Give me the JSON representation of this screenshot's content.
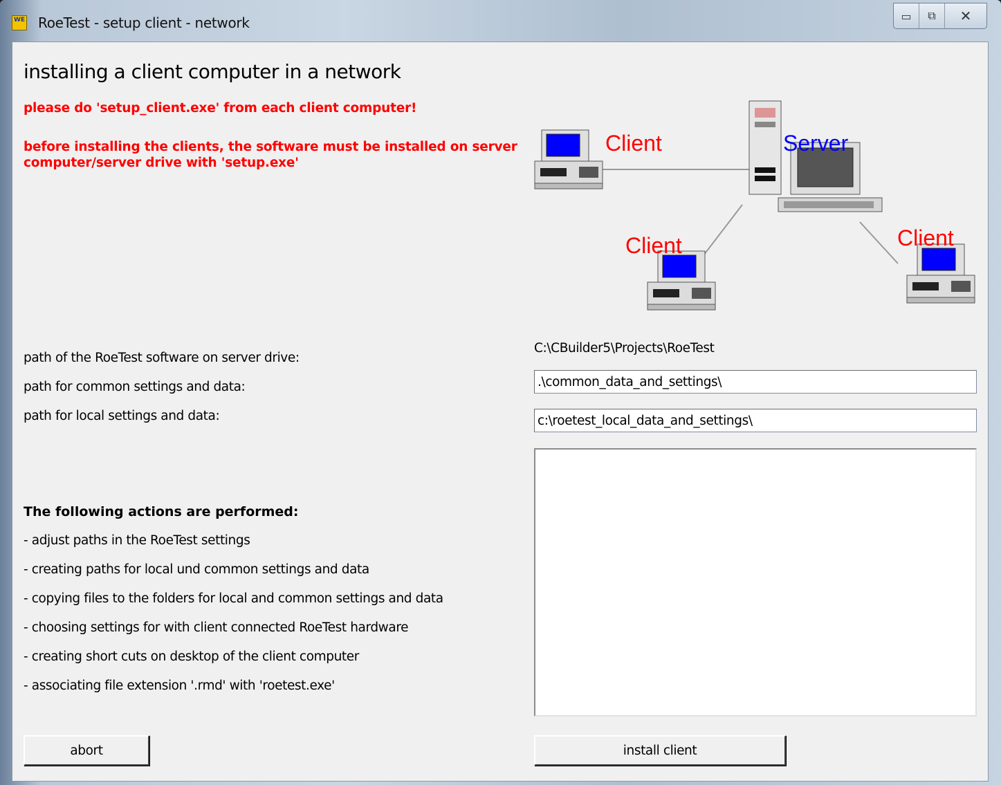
{
  "window": {
    "title": "RoeTest - setup client - network",
    "icon_text": "WE",
    "buttons": {
      "minimize": "▭",
      "maximize": "⧉",
      "close": "✕"
    }
  },
  "content": {
    "heading": "installing a client computer in a network",
    "warning1": "please do 'setup_client.exe' from each client computer!",
    "warning2_line1": "before installing the clients, the software must be installed on server",
    "warning2_line2": "computer/server drive with 'setup.exe'"
  },
  "diagram": {
    "client_label": "Client",
    "server_label": "Server",
    "colors": {
      "client": "#ff0000",
      "server": "#0000ff",
      "screen": "#0000ff"
    }
  },
  "paths": {
    "server_label": "path of the RoeTest software on server drive:",
    "server_value": "C:\\CBuilder5\\Projects\\RoeTest",
    "common_label": "path for common settings and data:",
    "common_value": ".\\common_data_and_settings\\",
    "local_label": "path for local settings and data:",
    "local_value": "c:\\roetest_local_data_and_settings\\"
  },
  "actions": {
    "title": "The following actions are performed:",
    "items": [
      "- adjust paths in the RoeTest settings",
      "- creating paths for local und common settings and data",
      "- copying files to the folders for local and common settings and data",
      "- choosing settings for with client connected RoeTest hardware",
      "- creating short cuts on desktop of the client computer",
      "- associating file extension '.rmd' with 'roetest.exe'"
    ]
  },
  "buttons": {
    "abort": "abort",
    "install": "install client"
  }
}
